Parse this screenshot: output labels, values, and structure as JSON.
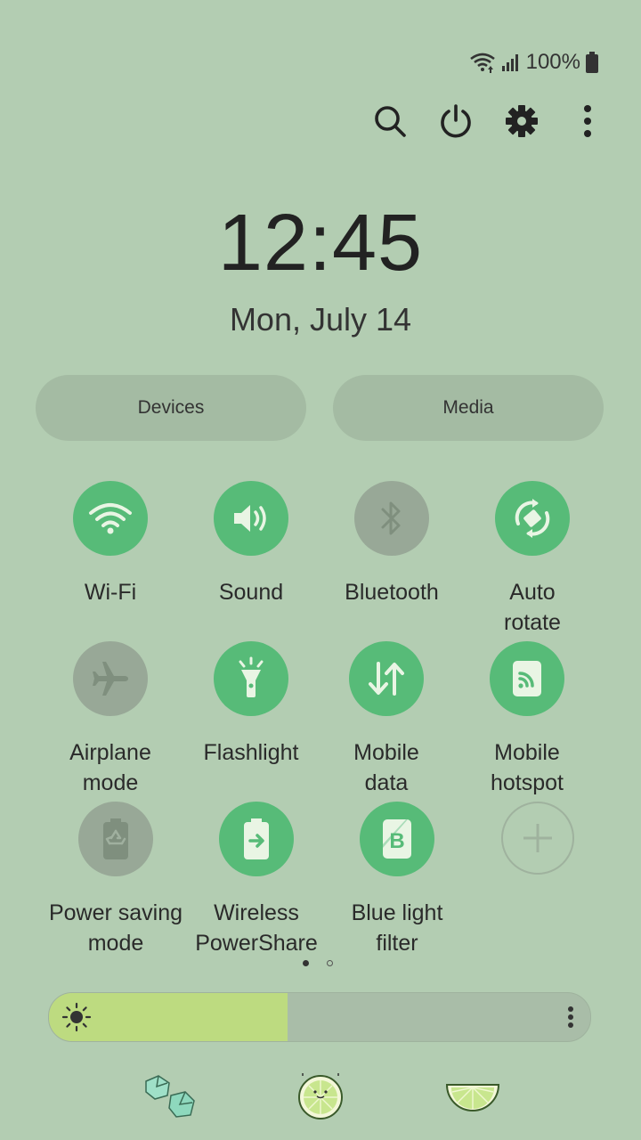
{
  "status_bar": {
    "battery_text": "100%",
    "icons": [
      "wifi-icon",
      "signal-icon",
      "battery-icon"
    ]
  },
  "top_actions": [
    "search-icon",
    "power-icon",
    "settings-gear-icon",
    "more-vert-icon"
  ],
  "clock": {
    "time": "12:45",
    "date": "Mon, July 14"
  },
  "pills": {
    "devices": "Devices",
    "media": "Media"
  },
  "tiles": [
    {
      "label": "Wi-Fi",
      "state": "on",
      "icon": "wifi-icon"
    },
    {
      "label": "Sound",
      "state": "on",
      "icon": "speaker-icon"
    },
    {
      "label": "Bluetooth",
      "state": "off",
      "icon": "bluetooth-icon"
    },
    {
      "label": "Auto\nrotate",
      "state": "on",
      "icon": "rotate-icon"
    },
    {
      "label": "Airplane\nmode",
      "state": "off",
      "icon": "airplane-icon"
    },
    {
      "label": "Flashlight",
      "state": "on",
      "icon": "flashlight-icon"
    },
    {
      "label": "Mobile\ndata",
      "state": "on",
      "icon": "mobile-data-icon"
    },
    {
      "label": "Mobile\nhotspot",
      "state": "on",
      "icon": "hotspot-icon"
    },
    {
      "label": "Power saving\nmode",
      "state": "off",
      "icon": "power-saving-icon"
    },
    {
      "label": "Wireless\nPowerShare",
      "state": "on",
      "icon": "powershare-icon"
    },
    {
      "label": "Blue light\nfilter",
      "state": "on",
      "icon": "blue-light-icon"
    },
    {
      "label": "",
      "state": "add",
      "icon": "add-icon"
    }
  ],
  "page_indicator": {
    "current": 1,
    "total": 2
  },
  "brightness": {
    "level": 0.44
  },
  "colors": {
    "background": "#b3cdb2",
    "tile_on": "#57bb78",
    "tile_off": "#98a897",
    "brightness_fill": "#bddb80"
  },
  "decorations": [
    "ice-cubes-icon",
    "lime-slice-face-icon",
    "lime-wedge-icon"
  ]
}
